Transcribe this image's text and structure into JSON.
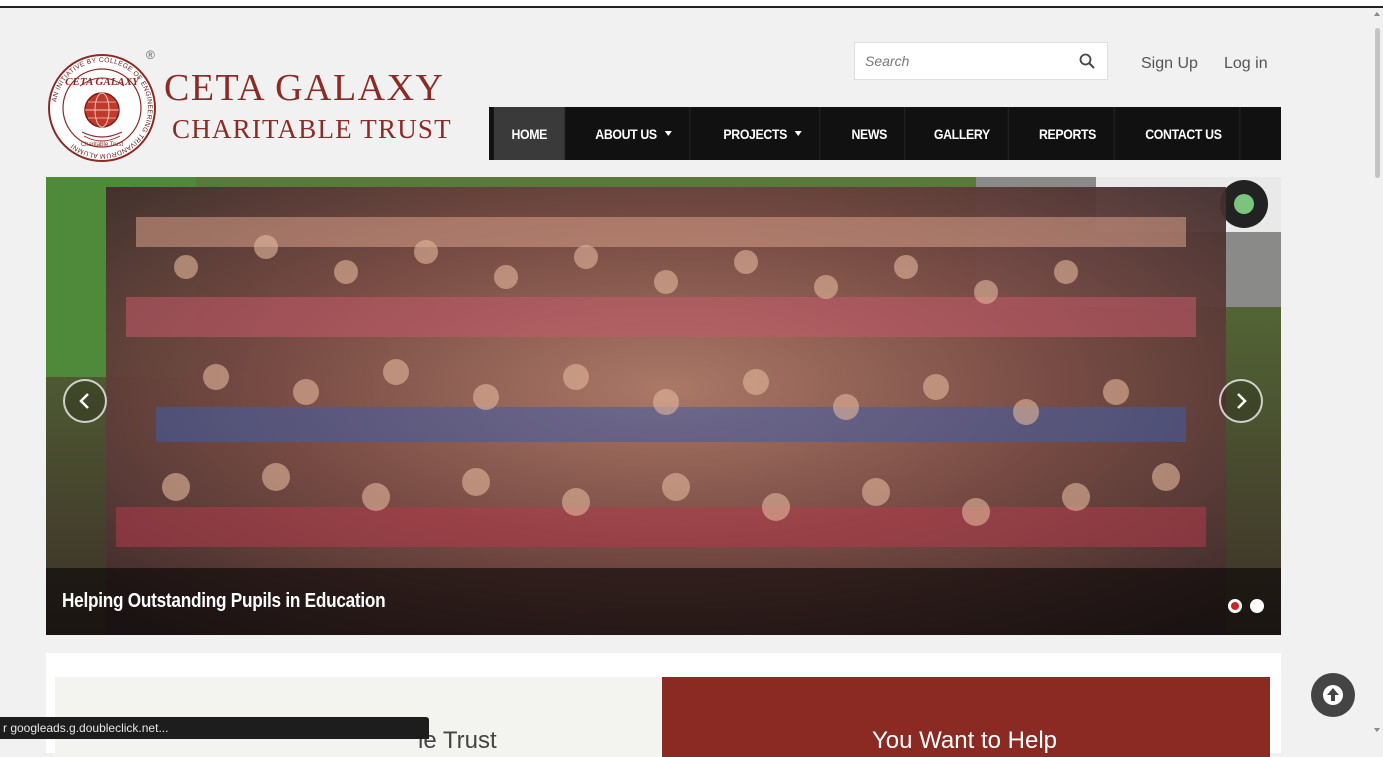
{
  "brand": {
    "line1": "CETA GALAXY",
    "line2": "CHARITABLE TRUST",
    "seal_ring_text": "AN INITIATIVE BY COLLEGE OF ENGINEERING TRIVANDRUM ALUMNI",
    "seal_center_text": "CETA GALAXY",
    "seal_bottom_text": "Charitable Trust",
    "registered_mark": "®",
    "color": "#8b2b26"
  },
  "search": {
    "placeholder": "Search",
    "icon": "search-icon"
  },
  "account": {
    "signup_label": "Sign Up",
    "login_label": "Log in"
  },
  "nav": {
    "items": [
      {
        "label": "HOME",
        "active": true,
        "has_dropdown": false
      },
      {
        "label": "ABOUT US",
        "active": false,
        "has_dropdown": true
      },
      {
        "label": "PROJECTS",
        "active": false,
        "has_dropdown": true
      },
      {
        "label": "NEWS",
        "active": false,
        "has_dropdown": false
      },
      {
        "label": "GALLERY",
        "active": false,
        "has_dropdown": false
      },
      {
        "label": "REPORTS",
        "active": false,
        "has_dropdown": false
      },
      {
        "label": "CONTACT US",
        "active": false,
        "has_dropdown": false
      }
    ]
  },
  "slider": {
    "caption": "Helping Outstanding Pupils in Education",
    "slide_count": 2,
    "active_slide": 1,
    "prev_icon": "chevron-left-icon",
    "next_icon": "chevron-right-icon"
  },
  "sections": {
    "left_title": "le Trust",
    "right_title": "You Want to Help"
  },
  "scroll_top_icon": "arrow-up-icon",
  "status_bar": "r googleads.g.doubleclick.net...",
  "colors": {
    "nav_bg": "#111111",
    "nav_active": "#3a3a3a",
    "accent_red": "#8a2a22",
    "dot_active": "#c62828"
  }
}
